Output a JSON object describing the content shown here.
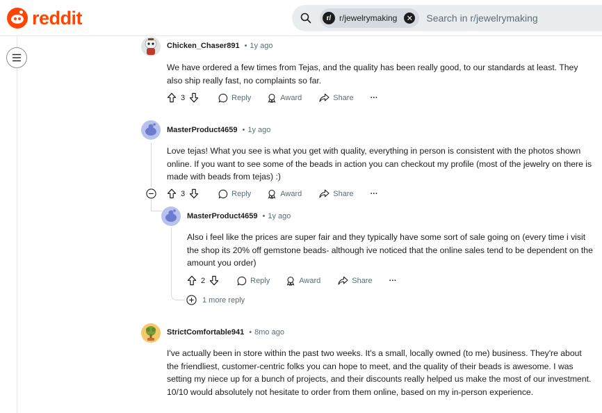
{
  "header": {
    "logo_text": "reddit",
    "search": {
      "community_chip": "r/jewelrymaking",
      "chip_avatar": "r/",
      "placeholder": "Search in r/jewelrymaking"
    }
  },
  "icons": {
    "vote_up": "upvote-arrow-icon",
    "vote_down": "downvote-arrow-icon",
    "reply": "speech-bubble-icon",
    "award": "award-ribbon-icon",
    "share": "share-arrow-icon",
    "more": "ellipsis-icon",
    "collapse": "minus-circle-icon",
    "expand": "plus-circle-icon",
    "menu": "hamburger-icon"
  },
  "colors": {
    "brand": "#ff4500",
    "meta": "#576f76",
    "search_bg": "#eaedef"
  },
  "labels": {
    "reply": "Reply",
    "award": "Award",
    "share": "Share",
    "more": "···"
  },
  "comments": [
    {
      "author": "Chicken_Chaser891",
      "dot": "•",
      "time": "1y ago",
      "body": "We have ordered a few times from Tejas, and the quality has been really good, to our standards at least. They also ship really fast, no complaints so far.",
      "score": "3"
    },
    {
      "author": "MasterProduct4659",
      "dot": "•",
      "time": "1y ago",
      "body": "Love tejas! What you see is what you get with quality, everything in person is consistent with the photos shown online. If you want to see some of the beads in action you can checkout my profile (most of the jewelry on there is made with beads from tejas) :)",
      "score": "3"
    },
    {
      "author": "MasterProduct4659",
      "dot": "•",
      "time": "1y ago",
      "body": "Also i feel like the prices are super fair and they typically have some sort of sale going on (every time i visit the shop its 20% off gemstone beads- although ive noticed that the online sales tend to be dependent on the amount you order)",
      "score": "2",
      "more_replies": "1 more reply"
    },
    {
      "author": "StrictComfortable941",
      "dot": "•",
      "time": "8mo ago",
      "body": "I've actually been in store within the past two weeks. It's a small, locally owned (to me) business. They're about the friendliest, customer-centric folks you can hope to meet, and the quality of their beads is awesome. I was setting my niece up for a bunch of projects, and their discounts really helped us make the most of our investment. 10/10 would absolutely not hesitate to order from them online, based on my in-person experience."
    }
  ]
}
